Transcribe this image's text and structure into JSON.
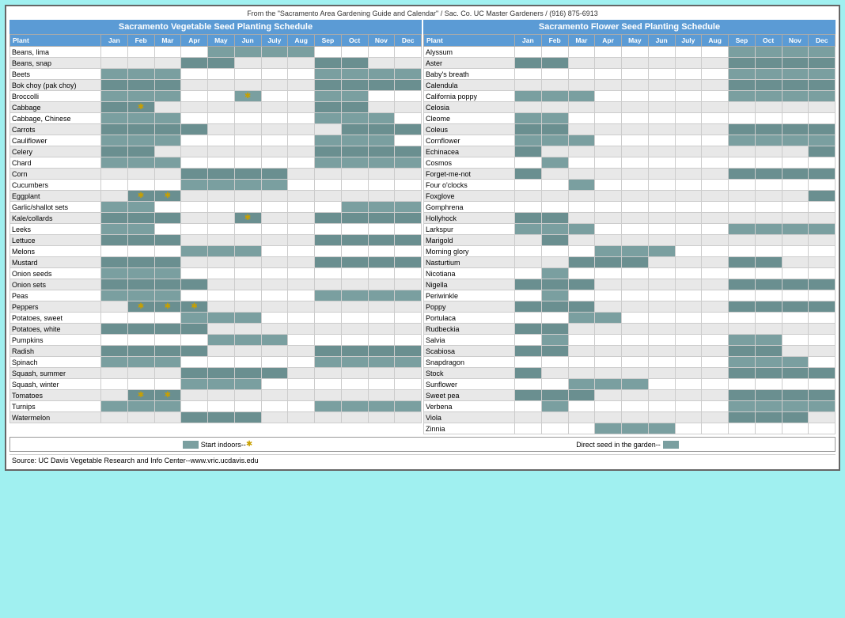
{
  "header": {
    "source": "From the \"Sacramento Area Gardening Guide and Calendar\" / Sac. Co. UC Master Gardeners / (916) 875-6913"
  },
  "vegTitle": "Sacramento Vegetable Seed Planting Schedule",
  "flowerTitle": "Sacramento Flower Seed Planting Schedule",
  "months": [
    "Jan",
    "Feb",
    "Mar",
    "Apr",
    "May",
    "Jun",
    "July",
    "Aug",
    "Sep",
    "Oct",
    "Nov",
    "Dec"
  ],
  "vegetables": [
    {
      "name": "Beans, lima",
      "months": [
        0,
        0,
        0,
        0,
        0,
        0,
        0,
        0,
        0,
        0,
        0,
        0
      ]
    },
    {
      "name": "Beans, snap",
      "months": [
        0,
        0,
        0,
        0,
        0,
        0,
        0,
        0,
        0,
        0,
        0,
        0
      ]
    },
    {
      "name": "Beets",
      "months": [
        0,
        0,
        0,
        0,
        0,
        0,
        0,
        0,
        0,
        0,
        0,
        0
      ]
    },
    {
      "name": "Bok choy (pak choy)",
      "months": [
        0,
        0,
        0,
        0,
        0,
        0,
        0,
        0,
        0,
        0,
        0,
        0
      ]
    },
    {
      "name": "Broccolli",
      "months": [
        0,
        0,
        0,
        0,
        0,
        0,
        0,
        0,
        0,
        0,
        0,
        0
      ]
    },
    {
      "name": "Cabbage",
      "months": [
        0,
        0,
        0,
        0,
        0,
        0,
        0,
        0,
        0,
        0,
        0,
        0
      ]
    },
    {
      "name": "Cabbage, Chinese",
      "months": [
        0,
        0,
        0,
        0,
        0,
        0,
        0,
        0,
        0,
        0,
        0,
        0
      ]
    },
    {
      "name": "Carrots",
      "months": [
        0,
        0,
        0,
        0,
        0,
        0,
        0,
        0,
        0,
        0,
        0,
        0
      ]
    },
    {
      "name": "Cauliflower",
      "months": [
        0,
        0,
        0,
        0,
        0,
        0,
        0,
        0,
        0,
        0,
        0,
        0
      ]
    },
    {
      "name": "Celery",
      "months": [
        0,
        0,
        0,
        0,
        0,
        0,
        0,
        0,
        0,
        0,
        0,
        0
      ]
    },
    {
      "name": "Chard",
      "months": [
        0,
        0,
        0,
        0,
        0,
        0,
        0,
        0,
        0,
        0,
        0,
        0
      ]
    },
    {
      "name": "Corn",
      "months": [
        0,
        0,
        0,
        0,
        0,
        0,
        0,
        0,
        0,
        0,
        0,
        0
      ]
    },
    {
      "name": "Cucumbers",
      "months": [
        0,
        0,
        0,
        0,
        0,
        0,
        0,
        0,
        0,
        0,
        0,
        0
      ]
    },
    {
      "name": "Eggplant",
      "months": [
        0,
        0,
        0,
        0,
        0,
        0,
        0,
        0,
        0,
        0,
        0,
        0
      ]
    },
    {
      "name": "Garlic/shallot sets",
      "months": [
        0,
        0,
        0,
        0,
        0,
        0,
        0,
        0,
        0,
        0,
        0,
        0
      ]
    },
    {
      "name": "Kale/collards",
      "months": [
        0,
        0,
        0,
        0,
        0,
        0,
        0,
        0,
        0,
        0,
        0,
        0
      ]
    },
    {
      "name": "Leeks",
      "months": [
        0,
        0,
        0,
        0,
        0,
        0,
        0,
        0,
        0,
        0,
        0,
        0
      ]
    },
    {
      "name": "Lettuce",
      "months": [
        0,
        0,
        0,
        0,
        0,
        0,
        0,
        0,
        0,
        0,
        0,
        0
      ]
    },
    {
      "name": "Melons",
      "months": [
        0,
        0,
        0,
        0,
        0,
        0,
        0,
        0,
        0,
        0,
        0,
        0
      ]
    },
    {
      "name": "Mustard",
      "months": [
        0,
        0,
        0,
        0,
        0,
        0,
        0,
        0,
        0,
        0,
        0,
        0
      ]
    },
    {
      "name": "Onion seeds",
      "months": [
        0,
        0,
        0,
        0,
        0,
        0,
        0,
        0,
        0,
        0,
        0,
        0
      ]
    },
    {
      "name": "Onion sets",
      "months": [
        0,
        0,
        0,
        0,
        0,
        0,
        0,
        0,
        0,
        0,
        0,
        0
      ]
    },
    {
      "name": "Peas",
      "months": [
        0,
        0,
        0,
        0,
        0,
        0,
        0,
        0,
        0,
        0,
        0,
        0
      ]
    },
    {
      "name": "Peppers",
      "months": [
        0,
        0,
        0,
        0,
        0,
        0,
        0,
        0,
        0,
        0,
        0,
        0
      ]
    },
    {
      "name": "Potatoes, sweet",
      "months": [
        0,
        0,
        0,
        0,
        0,
        0,
        0,
        0,
        0,
        0,
        0,
        0
      ]
    },
    {
      "name": "Potatoes, white",
      "months": [
        0,
        0,
        0,
        0,
        0,
        0,
        0,
        0,
        0,
        0,
        0,
        0
      ]
    },
    {
      "name": "Pumpkins",
      "months": [
        0,
        0,
        0,
        0,
        0,
        0,
        0,
        0,
        0,
        0,
        0,
        0
      ]
    },
    {
      "name": "Radish",
      "months": [
        0,
        0,
        0,
        0,
        0,
        0,
        0,
        0,
        0,
        0,
        0,
        0
      ]
    },
    {
      "name": "Spinach",
      "months": [
        0,
        0,
        0,
        0,
        0,
        0,
        0,
        0,
        0,
        0,
        0,
        0
      ]
    },
    {
      "name": "Squash, summer",
      "months": [
        0,
        0,
        0,
        0,
        0,
        0,
        0,
        0,
        0,
        0,
        0,
        0
      ]
    },
    {
      "name": "Squash, winter",
      "months": [
        0,
        0,
        0,
        0,
        0,
        0,
        0,
        0,
        0,
        0,
        0,
        0
      ]
    },
    {
      "name": "Tomatoes",
      "months": [
        0,
        0,
        0,
        0,
        0,
        0,
        0,
        0,
        0,
        0,
        0,
        0
      ]
    },
    {
      "name": "Turnips",
      "months": [
        0,
        0,
        0,
        0,
        0,
        0,
        0,
        0,
        0,
        0,
        0,
        0
      ]
    },
    {
      "name": "Watermelon",
      "months": [
        0,
        0,
        0,
        0,
        0,
        0,
        0,
        0,
        0,
        0,
        0,
        0
      ]
    }
  ],
  "flowers": [
    {
      "name": "Alyssum"
    },
    {
      "name": "Aster"
    },
    {
      "name": "Baby's breath"
    },
    {
      "name": "Calendula"
    },
    {
      "name": "California poppy"
    },
    {
      "name": "Celosia"
    },
    {
      "name": "Cleome"
    },
    {
      "name": "Coleus"
    },
    {
      "name": "Cornflower"
    },
    {
      "name": "Echinacea"
    },
    {
      "name": "Cosmos"
    },
    {
      "name": "Forget-me-not"
    },
    {
      "name": "Four o'clocks"
    },
    {
      "name": "Foxglove"
    },
    {
      "name": "Gomphrena"
    },
    {
      "name": "Hollyhock"
    },
    {
      "name": "Larkspur"
    },
    {
      "name": "Marigold"
    },
    {
      "name": "Morning glory"
    },
    {
      "name": "Nasturtium"
    },
    {
      "name": "Nicotiana"
    },
    {
      "name": "Nigella"
    },
    {
      "name": "Periwinkle"
    },
    {
      "name": "Poppy"
    },
    {
      "name": "Portulaca"
    },
    {
      "name": "Rudbeckia"
    },
    {
      "name": "Salvia"
    },
    {
      "name": "Scabiosa"
    },
    {
      "name": "Snapdragon"
    },
    {
      "name": "Stock"
    },
    {
      "name": "Sunflower"
    },
    {
      "name": "Sweet pea"
    },
    {
      "name": "Verbena"
    },
    {
      "name": "Viola"
    },
    {
      "name": "Zinnia"
    }
  ],
  "legend": {
    "startIndoors": "Start indoors--",
    "directSeed": "Direct seed in the garden--",
    "source": "Source:  UC Davis Vegetable Research and Info Center--www.vric.ucdavis.edu"
  }
}
